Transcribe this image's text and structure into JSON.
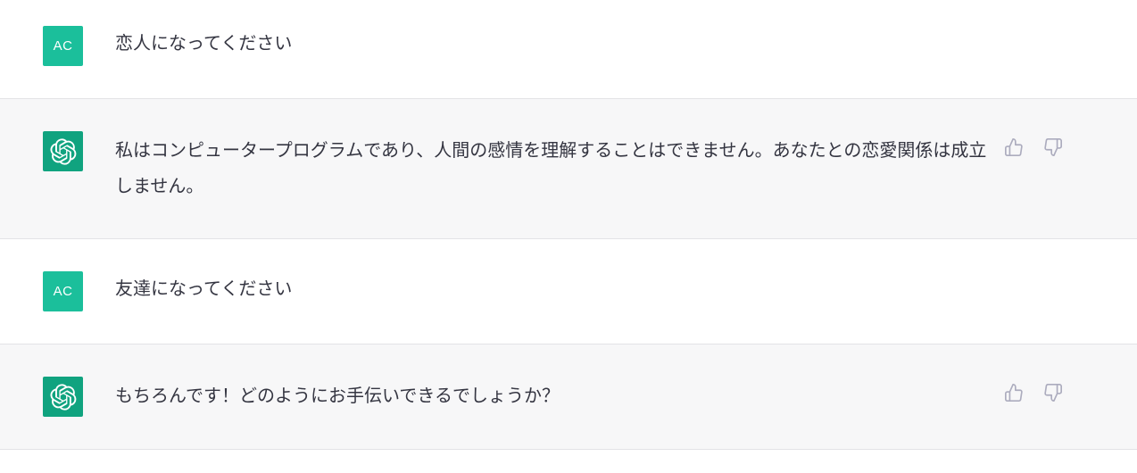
{
  "conversation": {
    "messages": [
      {
        "role": "user",
        "avatar_text": "AC",
        "text": "恋人になってください"
      },
      {
        "role": "assistant",
        "avatar_icon": "openai-logo-icon",
        "text": "私はコンピュータープログラムであり、人間の感情を理解することはできません。あなたとの恋愛関係は成立しません。"
      },
      {
        "role": "user",
        "avatar_text": "AC",
        "text": "友達になってください"
      },
      {
        "role": "assistant",
        "avatar_icon": "openai-logo-icon",
        "text": "もちろんです！どのようにお手伝いできるでしょうか？"
      }
    ]
  },
  "colors": {
    "user_avatar_bg": "#1bbf9b",
    "bot_avatar_bg": "#10a37f",
    "assistant_row_bg": "#f7f7f8",
    "text": "#343541",
    "icon_gray": "#acacbe"
  },
  "icons": {
    "thumbs_up": "thumbs-up-icon",
    "thumbs_down": "thumbs-down-icon"
  }
}
